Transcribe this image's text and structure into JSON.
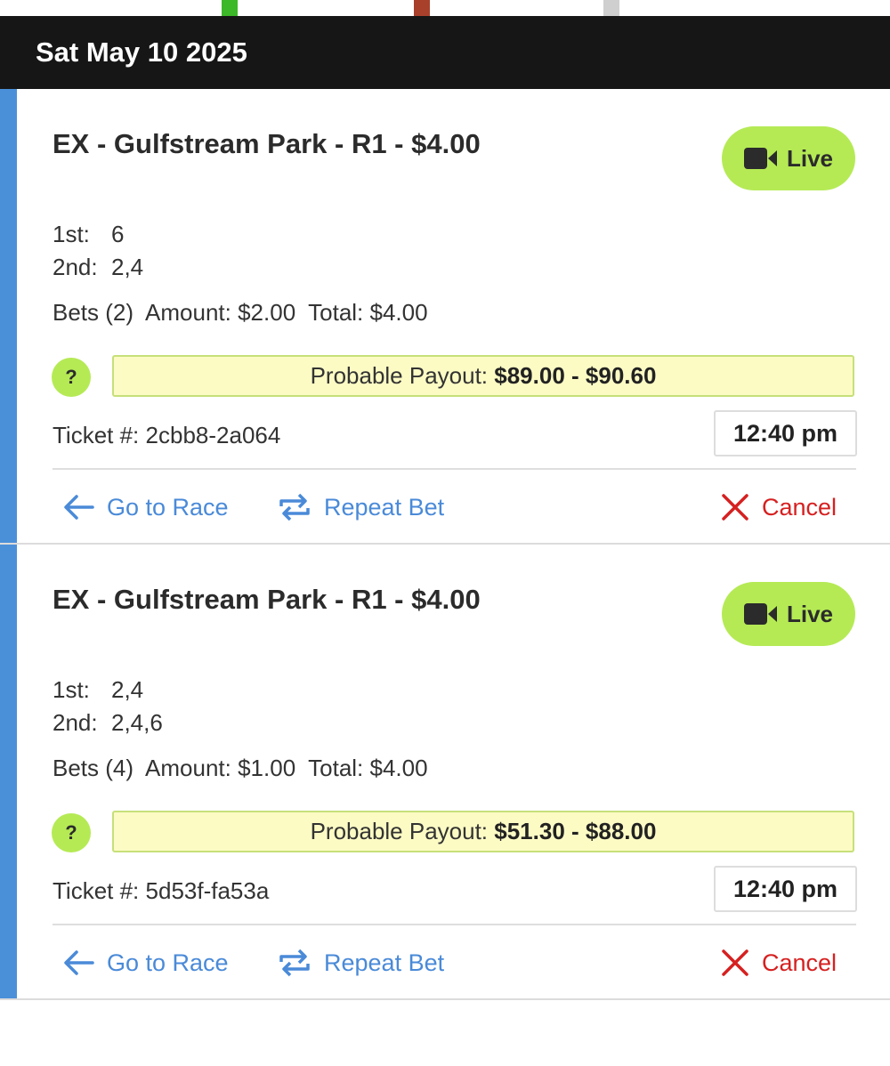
{
  "header": {
    "date": "Sat May 10 2025"
  },
  "top_strip_colors": [
    "#3cb828",
    "#a9402c",
    "#cfcfcf"
  ],
  "tickets": [
    {
      "title": "EX - Gulfstream Park - R1 - $4.00",
      "live_label": "Live",
      "first_label": "1st:",
      "first_value": "6",
      "second_label": "2nd:",
      "second_value": "2,4",
      "bets_line": "Bets (2)  Amount: $2.00  Total: $4.00",
      "payout_label": "Probable Payout:",
      "payout_value": "$89.00 - $90.60",
      "help_label": "?",
      "ticket_label": "Ticket #:",
      "ticket_number": "2cbb8-2a064",
      "time": "12:40 pm",
      "go_to_race": "Go to Race",
      "repeat_bet": "Repeat Bet",
      "cancel": "Cancel"
    },
    {
      "title": "EX - Gulfstream Park - R1 - $4.00",
      "live_label": "Live",
      "first_label": "1st:",
      "first_value": "2,4",
      "second_label": "2nd:",
      "second_value": "2,4,6",
      "bets_line": "Bets (4)  Amount: $1.00  Total: $4.00",
      "payout_label": "Probable Payout:",
      "payout_value": "$51.30 - $88.00",
      "help_label": "?",
      "ticket_label": "Ticket #:",
      "ticket_number": "5d53f-fa53a",
      "time": "12:40 pm",
      "go_to_race": "Go to Race",
      "repeat_bet": "Repeat Bet",
      "cancel": "Cancel"
    }
  ],
  "colors": {
    "accent_blue": "#4a8ad8",
    "live_green": "#b5ea55",
    "cancel_red": "#d62020",
    "payout_bg": "#fcfbc4"
  }
}
